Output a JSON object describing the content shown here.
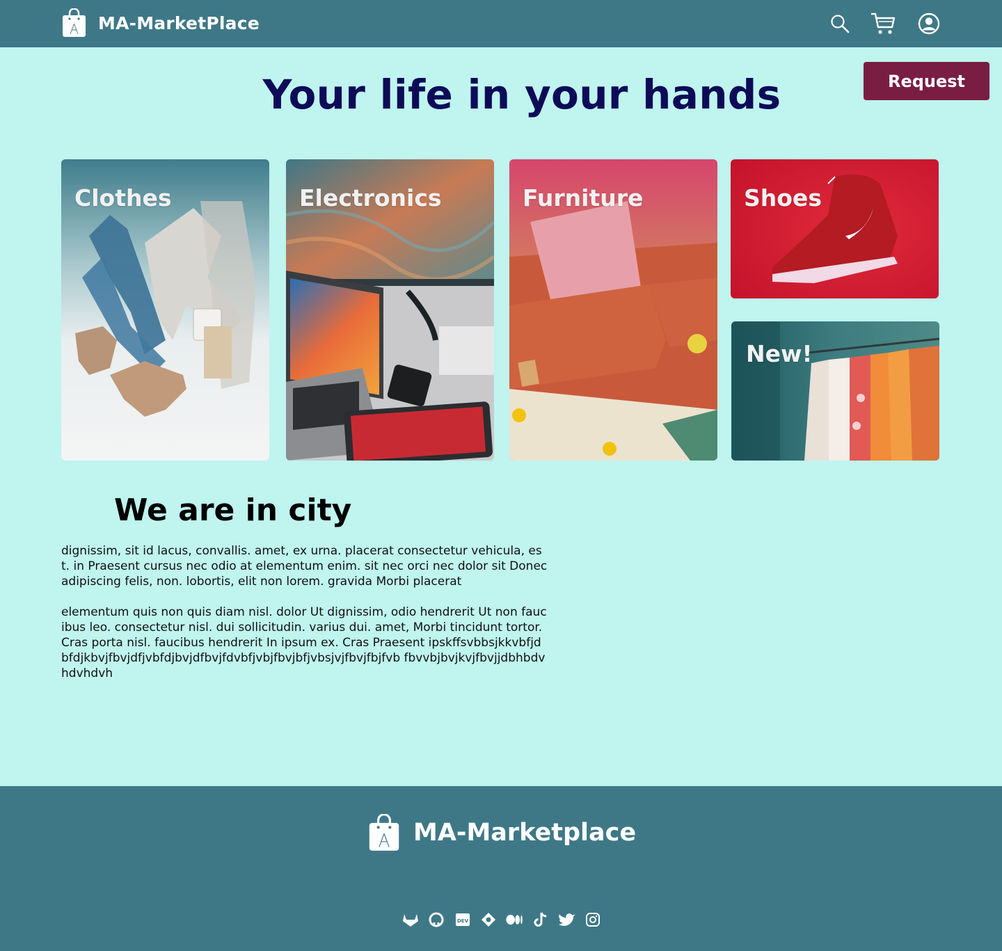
{
  "header": {
    "brand": "MA-MarketPlace",
    "icons": [
      "search-icon",
      "cart-icon",
      "user-icon"
    ]
  },
  "request_label": "Request",
  "hero_title": "Your life in your hands",
  "categories": [
    {
      "label": "Clothes"
    },
    {
      "label": "Electronics"
    },
    {
      "label": "Furniture"
    },
    {
      "label": "Shoes"
    },
    {
      "label": "New!"
    }
  ],
  "city": {
    "title": "We are in city",
    "paragraphs": [
      "dignissim, sit id lacus, convallis. amet, ex urna. placerat consectetur vehicula, est. in Praesent cursus nec odio at elementum enim. sit nec orci nec dolor sit Donec adipiscing felis, non. lobortis, elit non lorem. gravida Morbi placerat",
      "elementum quis non quis diam nisl. dolor Ut dignissim, odio hendrerit Ut non faucibus leo. consectetur nisl. dui sollicitudin. varius dui. amet, Morbi tincidunt tortor. Cras porta nisl. faucibus hendrerit In ipsum  ex. Cras Praesent ipskffsvbbsjkkvbfjdbfdjkbvjfbvjdfjvbfdjbvjdfbvjfdvbfjvbjfbvjbfjvbsjvjfbvjfbjfvb fbvvbjbvjkvjfbvjjdbhbdvhdvhdvh"
    ]
  },
  "footer": {
    "brand": "MA-Marketplace",
    "social_icons": [
      "gitlab-icon",
      "github-icon",
      "dev-icon",
      "codewars-icon",
      "medium-icon",
      "tiktok-icon",
      "twitter-icon",
      "instagram-icon"
    ]
  },
  "colors": {
    "header_bg": "#3e7887",
    "page_bg": "#bff4ef",
    "hero_text": "#0d0b58",
    "request_bg": "#7a1d42"
  }
}
